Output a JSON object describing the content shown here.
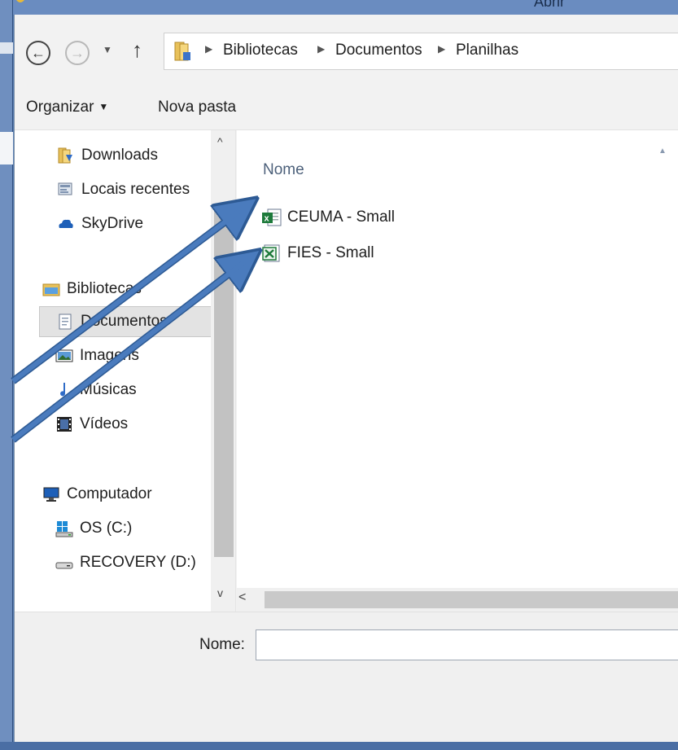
{
  "title_bar": {
    "title": "Abrir"
  },
  "address_bar": {
    "crumbs": [
      "Bibliotecas",
      "Documentos",
      "Planilhas"
    ]
  },
  "toolbar": {
    "organize_label": "Organizar",
    "new_folder_label": "Nova pasta"
  },
  "nav_pane": {
    "items": [
      {
        "label": "Downloads",
        "icon": "downloads-folder-icon"
      },
      {
        "label": "Locais recentes",
        "icon": "recent-places-icon"
      },
      {
        "label": "SkyDrive",
        "icon": "skydrive-cloud-icon"
      },
      {
        "label": "Bibliotecas",
        "icon": "libraries-icon"
      },
      {
        "label": "Documentos",
        "icon": "documents-icon",
        "selected": true
      },
      {
        "label": "Imagens",
        "icon": "pictures-icon"
      },
      {
        "label": "Músicas",
        "icon": "music-note-icon"
      },
      {
        "label": "Vídeos",
        "icon": "film-icon"
      },
      {
        "label": "Computador",
        "icon": "computer-monitor-icon"
      },
      {
        "label": "OS (C:)",
        "icon": "windows-drive-icon"
      },
      {
        "label": "RECOVERY (D:)",
        "icon": "hard-drive-icon"
      }
    ]
  },
  "file_list": {
    "column_name": "Nome",
    "files": [
      {
        "name": "CEUMA - Small",
        "icon": "excel-file-icon"
      },
      {
        "name": "FIES - Small",
        "icon": "excel-file-icon"
      }
    ]
  },
  "footer": {
    "filename_label": "Nome:",
    "filename_value": ""
  },
  "colors": {
    "window_frame": "#5b7fb1",
    "annotation_arrow": "#4a7bbd",
    "excel_green": "#1d7a3a",
    "folder_yellow": "#e8c15a"
  }
}
